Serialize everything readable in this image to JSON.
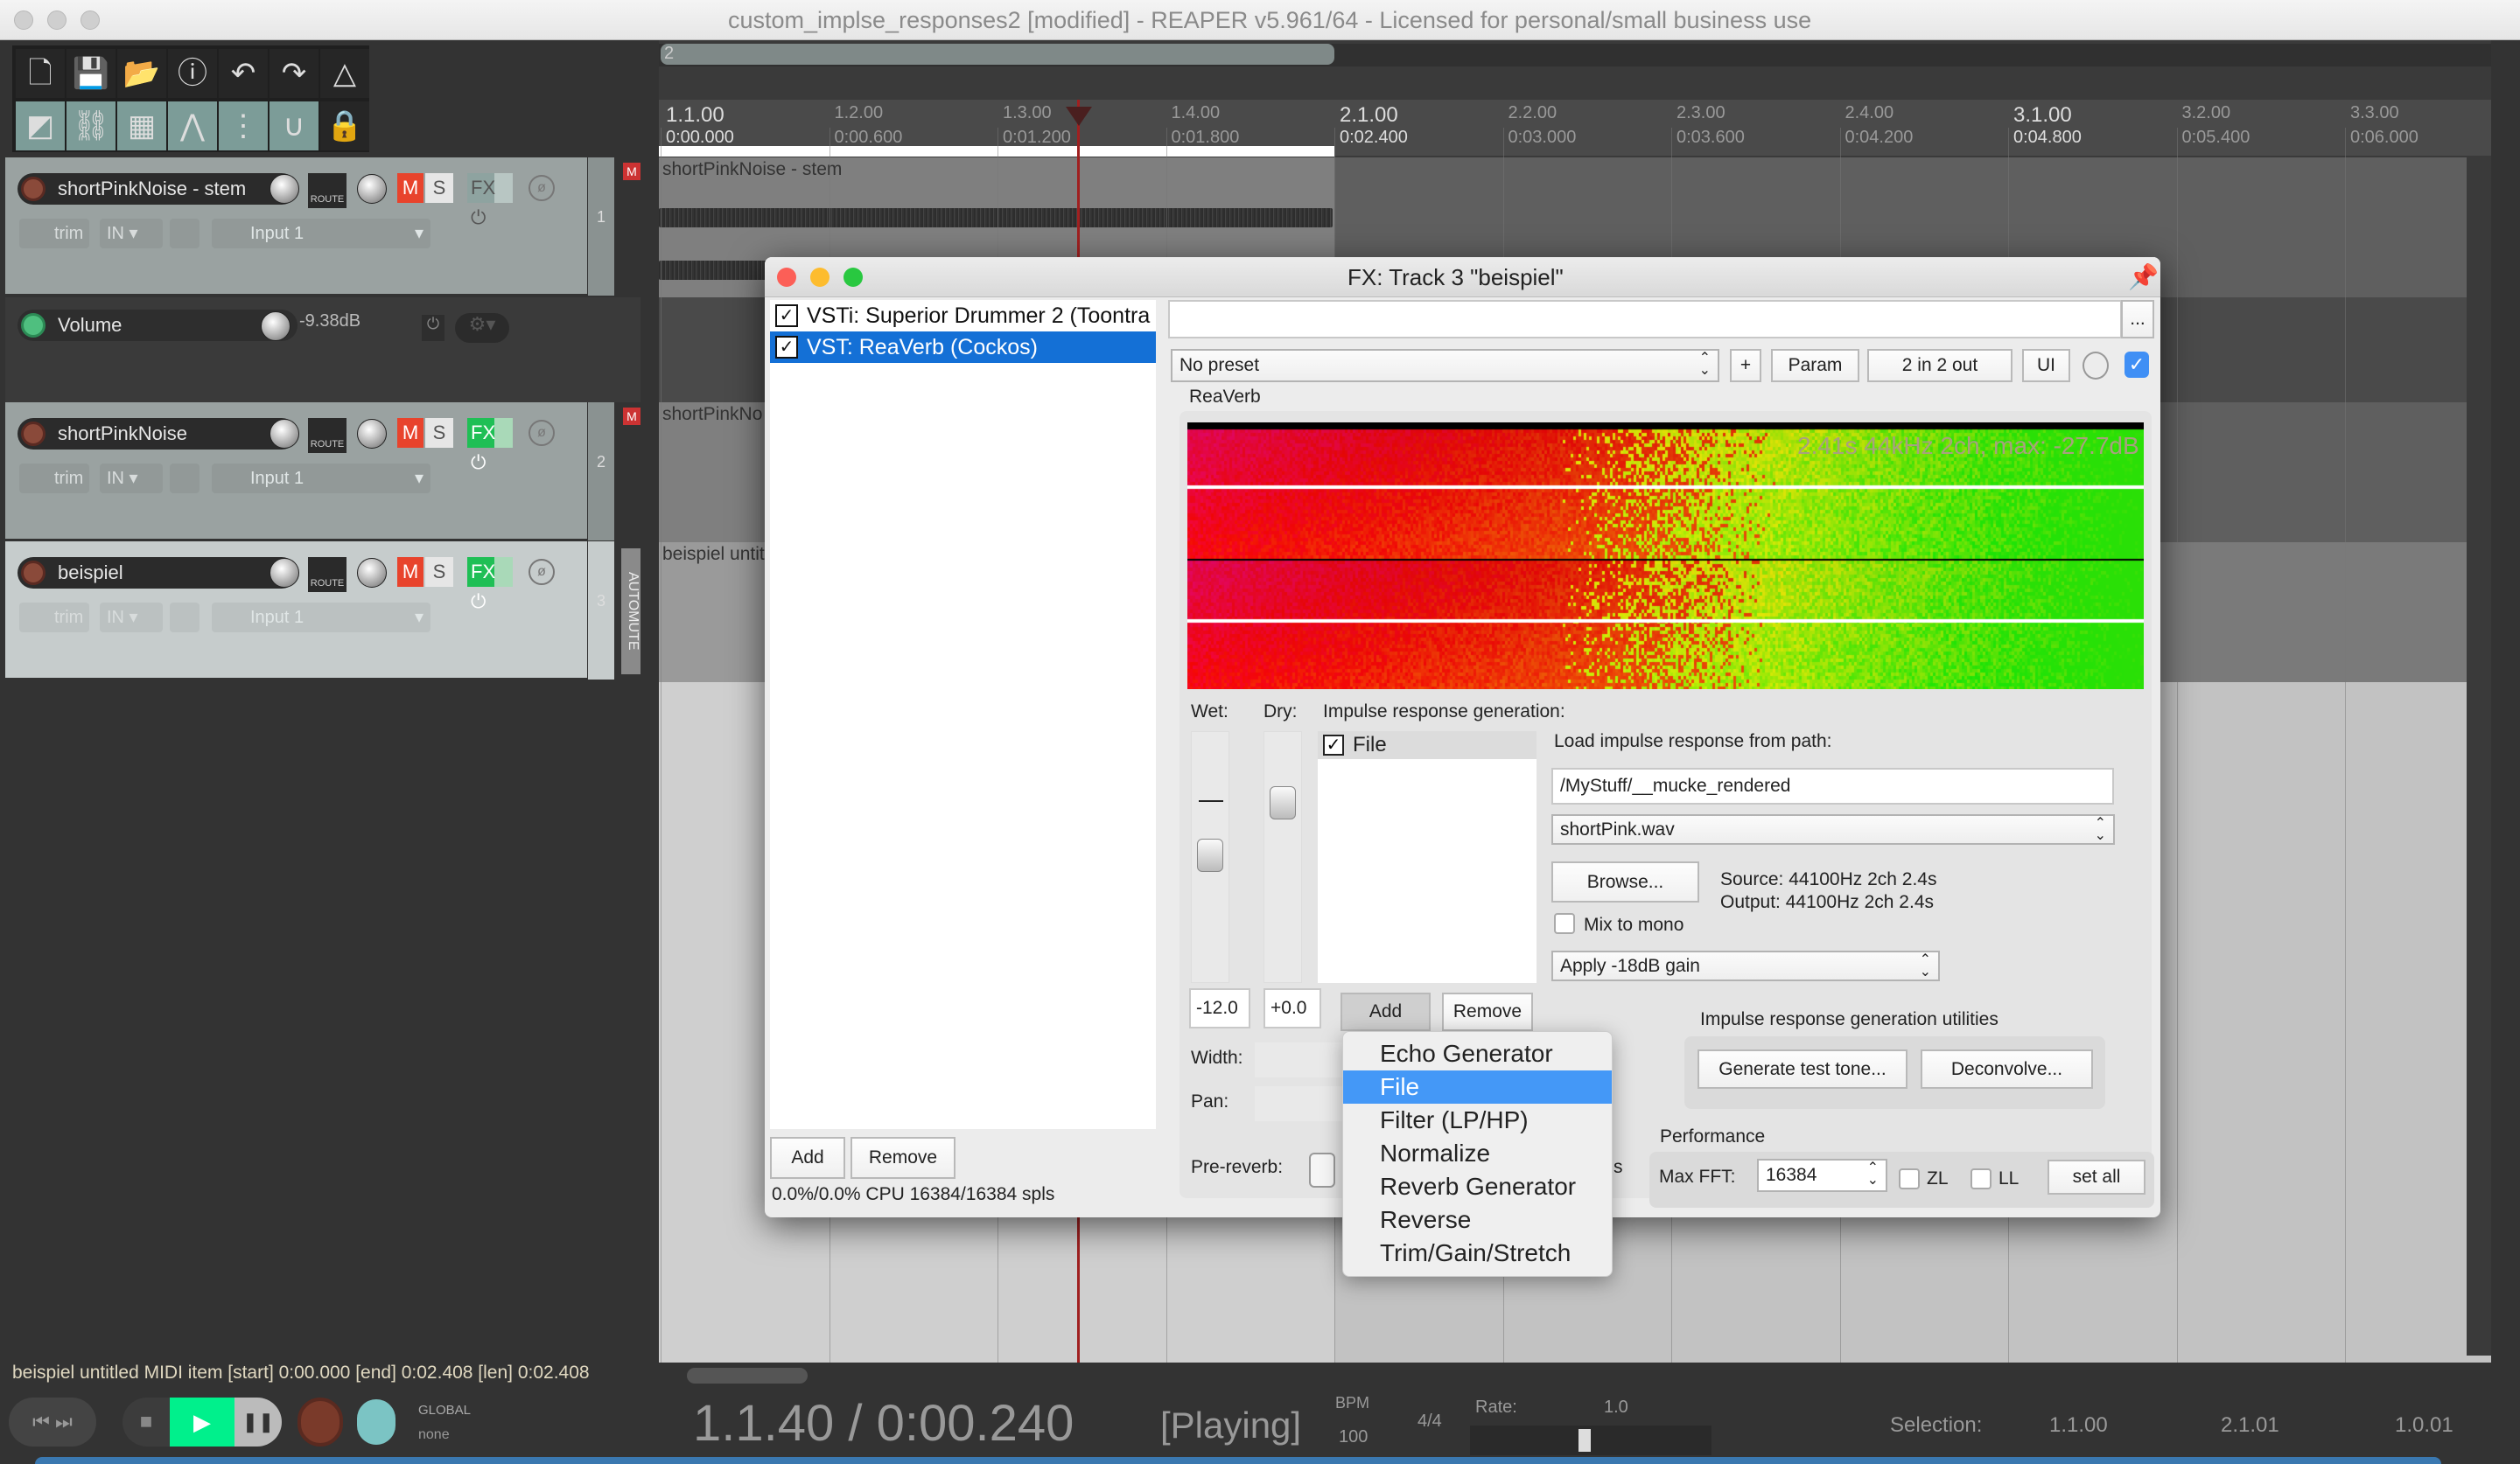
{
  "window": {
    "title": "custom_implse_responses2 [modified] - REAPER v5.961/64 - Licensed for personal/small business use"
  },
  "toolbar": {
    "icons": [
      "new-project-icon",
      "save-project-icon",
      "open-project-icon",
      "project-info-icon",
      "undo-icon",
      "redo-icon",
      "metronome-icon",
      "auto-crossfade-icon",
      "ripple-edit-icon",
      "grouping-icon",
      "envelope-points-icon",
      "grid-icon",
      "snap-icon",
      "lock-icon"
    ]
  },
  "tracks": [
    {
      "name": "shortPinkNoise - stem",
      "number": "1",
      "trim": "trim",
      "in": "IN",
      "input": "Input 1",
      "route": "ROUTE",
      "mute": "M",
      "solo": "S",
      "fx": "FX",
      "fx_active": false,
      "muted_indicator": "M"
    },
    {
      "name": "shortPinkNoise",
      "number": "2",
      "trim": "trim",
      "in": "IN",
      "input": "Input 1",
      "route": "ROUTE",
      "mute": "M",
      "solo": "S",
      "fx": "FX",
      "fx_active": true,
      "muted_indicator": "M"
    },
    {
      "name": "beispiel",
      "number": "3",
      "trim": "trim",
      "in": "IN",
      "input": "Input 1",
      "route": "ROUTE",
      "mute": "M",
      "solo": "S",
      "fx": "FX",
      "fx_active": true,
      "automute": "AUTOMUTE"
    }
  ],
  "envelope": {
    "name": "Volume",
    "value": "-9.38dB"
  },
  "ruler": {
    "region": "2",
    "bars": [
      "1.1.00",
      "1.2.00",
      "1.3.00",
      "1.4.00",
      "2.1.00",
      "2.2.00",
      "2.3.00",
      "2.4.00",
      "3.1.00",
      "3.2.00",
      "3.3.00"
    ],
    "times": [
      "0:00.000",
      "0:00.600",
      "0:01.200",
      "0:01.800",
      "0:02.400",
      "0:03.000",
      "0:03.600",
      "0:04.200",
      "0:04.800",
      "0:05.400",
      "0:06.000"
    ]
  },
  "items": {
    "track1": "shortPinkNoise - stem",
    "track2": "shortPinkNo",
    "track3": "beispiel untit"
  },
  "fx": {
    "title": "FX: Track 3 \"beispiel\"",
    "chain": [
      {
        "label": "VSTi: Superior Drummer 2 (Toontra",
        "checked": true,
        "selected": false
      },
      {
        "label": "VST: ReaVerb (Cockos)",
        "checked": true,
        "selected": true
      }
    ],
    "add": "Add",
    "remove": "Remove",
    "cpu": "0.0%/0.0% CPU 16384/16384 spls",
    "more": "...",
    "preset": "No preset",
    "plus": "+",
    "param": "Param",
    "io": "2 in 2 out",
    "ui": "UI",
    "plugin_name": "ReaVerb",
    "spectrogram_info": "2.41s 44kHz 2ch, max: -27.7dB",
    "wet_label": "Wet:",
    "dry_label": "Dry:",
    "wet_value": "-12.0",
    "dry_value": "+0.0",
    "irgen_label": "Impulse response generation:",
    "irgen_items": [
      {
        "label": "File",
        "checked": true
      }
    ],
    "ir_add": "Add",
    "ir_remove": "Remove",
    "load_label": "Load impulse response from path:",
    "path": "/MyStuff/__mucke_rendered",
    "file": "shortPink.wav",
    "browse": "Browse...",
    "source": "Source: 44100Hz 2ch 2.4s",
    "output": "Output: 44100Hz 2ch 2.4s",
    "mix_to_mono": "Mix to mono",
    "gain": "Apply -18dB gain",
    "utilities_label": "Impulse response generation utilities",
    "generate": "Generate test tone...",
    "deconvolve": "Deconvolve...",
    "width_label": "Width:",
    "pan_label": "Pan:",
    "prereverb_label": "Pre-reverb:",
    "prereverb_suffix": "s",
    "performance_label": "Performance",
    "maxfft_label": "Max FFT:",
    "maxfft": "16384",
    "zl": "ZL",
    "ll": "LL",
    "set_all": "set all"
  },
  "menu": {
    "items": [
      "Echo Generator",
      "File",
      "Filter (LP/HP)",
      "Normalize",
      "Reverb Generator",
      "Reverse",
      "Trim/Gain/Stretch"
    ],
    "highlighted": "File"
  },
  "status": "beispiel untitled MIDI item [start] 0:00.000 [end] 0:02.408 [len] 0:02.408",
  "transport": {
    "time": "1.1.40 / 0:00.240",
    "state": "[Playing]",
    "bpm_label": "BPM",
    "bpm": "100",
    "signature": "4/4",
    "rate_label": "Rate:",
    "rate": "1.0",
    "global": "GLOBAL",
    "automation_mode": "none",
    "selection_label": "Selection:",
    "selection_start": "1.1.00",
    "selection_end": "2.1.01",
    "selection_length": "1.0.01"
  },
  "colors": {
    "accent": "#4498f7",
    "mute": "#e8432c",
    "fx_active": "#1fbf55",
    "play": "#00f08c",
    "playhead": "#c0302a"
  }
}
